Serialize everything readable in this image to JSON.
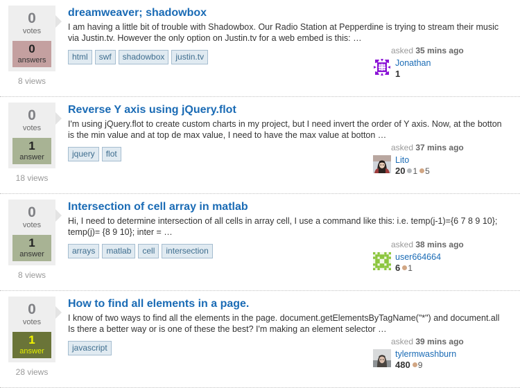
{
  "labels": {
    "votes": "votes",
    "answer_singular": "answer",
    "answer_plural": "answers",
    "asked_prefix": "asked"
  },
  "questions": [
    {
      "votes": "0",
      "votes_label": "votes",
      "answers": "0",
      "answers_label": "answers",
      "answer_state": "unanswered",
      "views": "8 views",
      "title": "dreamweaver; shadowbox",
      "excerpt": "I am having a little bit of trouble with Shadowbox. Our Radio Station at Pepperdine is trying to stream their music via Justin.tv. However the only option on Justin.tv for a web embed is this: …",
      "tags": [
        "html",
        "swf",
        "shadowbox",
        "justin.tv"
      ],
      "asked_prefix": "asked",
      "asked_time": "35 mins ago",
      "user": {
        "name": "Jonathan",
        "reputation": "1",
        "avatar_type": "identicon-purple",
        "badges": []
      }
    },
    {
      "votes": "0",
      "votes_label": "votes",
      "answers": "1",
      "answers_label": "answer",
      "answer_state": "answered",
      "views": "18 views",
      "title": "Reverse Y axis using jQuery.flot",
      "excerpt": "I'm using jQuery.flot to create custom charts in my project, but I need invert the order of Y axis. Now, at the botton is the min value and at top de max value, I need to have the max value at botton …",
      "tags": [
        "jquery",
        "flot"
      ],
      "asked_prefix": "asked",
      "asked_time": "37 mins ago",
      "user": {
        "name": "Lito",
        "reputation": "20",
        "avatar_type": "photo-woman",
        "badges": [
          {
            "type": "silver",
            "count": "1"
          },
          {
            "type": "bronze",
            "count": "5"
          }
        ]
      }
    },
    {
      "votes": "0",
      "votes_label": "votes",
      "answers": "1",
      "answers_label": "answer",
      "answer_state": "answered",
      "views": "8 views",
      "title": "Intersection of cell array in matlab",
      "excerpt": "Hi, I need to determine intersection of all cells in array cell, I use a command like this: i.e. temp(j-1)={6 7 8 9 10}; temp(j)= {8 9 10}; inter = …",
      "tags": [
        "arrays",
        "matlab",
        "cell",
        "intersection"
      ],
      "asked_prefix": "asked",
      "asked_time": "38 mins ago",
      "user": {
        "name": "user664664",
        "reputation": "6",
        "avatar_type": "identicon-green",
        "badges": [
          {
            "type": "bronze",
            "count": "1"
          }
        ]
      }
    },
    {
      "votes": "0",
      "votes_label": "votes",
      "answers": "1",
      "answers_label": "answer",
      "answer_state": "accepted",
      "views": "28 views",
      "title": "How to find all elements in a page.",
      "excerpt": "I know of two ways to find all the elements in the page. document.getElementsByTagName(\"*\") and document.all Is there a better way or is one of these the best? I'm making an element selector …",
      "tags": [
        "javascript"
      ],
      "asked_prefix": "asked",
      "asked_time": "39 mins ago",
      "user": {
        "name": "tylermwashburn",
        "reputation": "480",
        "avatar_type": "photo-person",
        "badges": [
          {
            "type": "bronze",
            "count": "9"
          }
        ]
      }
    }
  ],
  "colors": {
    "link": "#1a6bb5",
    "unanswered_bg": "#c4a0a0",
    "answered_bg": "#a8b394",
    "accepted_bg": "#6a7438",
    "accepted_text": "#e9f000",
    "tag_bg": "#e0eaf1",
    "tag_border": "#a5bdd0",
    "tag_text": "#3e6d8e",
    "stats_bg": "#eeeeee"
  }
}
